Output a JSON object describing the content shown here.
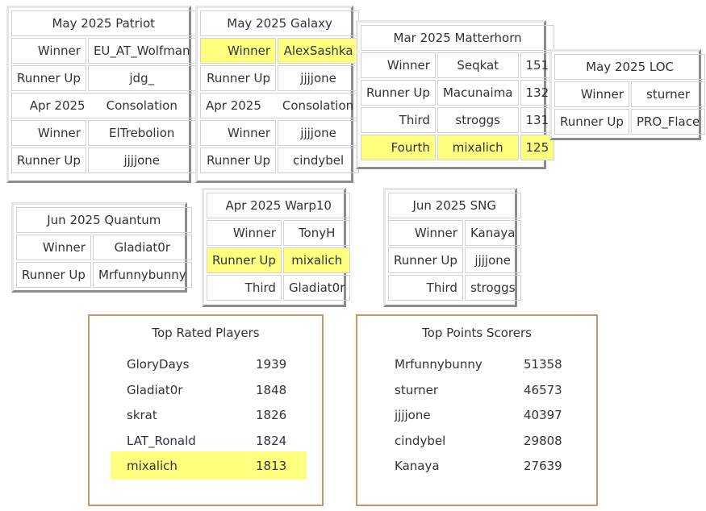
{
  "tournaments": {
    "patriot": {
      "title": "May 2025 Patriot",
      "rows": [
        {
          "label": "Winner",
          "name": "EU_AT_Wolfman"
        },
        {
          "label": "Runner Up",
          "name": "jdg_"
        }
      ],
      "consolation": {
        "month": "Apr 2025",
        "label": "Consolation",
        "rows": [
          {
            "label": "Winner",
            "name": "ElTrebolion"
          },
          {
            "label": "Runner Up",
            "name": "jjjjone"
          }
        ]
      }
    },
    "galaxy": {
      "title": "May 2025 Galaxy",
      "rows": [
        {
          "label": "Winner",
          "name": "AlexSashka"
        },
        {
          "label": "Runner Up",
          "name": "jjjjone"
        }
      ],
      "consolation": {
        "month": "Apr 2025",
        "label": "Consolation",
        "rows": [
          {
            "label": "Winner",
            "name": "jjjjone"
          },
          {
            "label": "Runner Up",
            "name": "cindybel"
          }
        ]
      }
    },
    "matterhorn": {
      "title": "Mar 2025 Matterhorn",
      "rows": [
        {
          "label": "Winner",
          "name": "Seqkat",
          "score": "151"
        },
        {
          "label": "Runner Up",
          "name": "Macunaima",
          "score": "132"
        },
        {
          "label": "Third",
          "name": "stroggs",
          "score": "131"
        },
        {
          "label": "Fourth",
          "name": "mixalich",
          "score": "125"
        }
      ]
    },
    "loc": {
      "title": "May 2025 LOC",
      "rows": [
        {
          "label": "Winner",
          "name": "sturner"
        },
        {
          "label": "Runner Up",
          "name": "PRO_Flace"
        }
      ]
    },
    "quantum": {
      "title": "Jun 2025 Quantum",
      "rows": [
        {
          "label": "Winner",
          "name": "Gladiat0r"
        },
        {
          "label": "Runner Up",
          "name": "Mrfunnybunny"
        }
      ]
    },
    "warp10": {
      "title": "Apr 2025 Warp10",
      "rows": [
        {
          "label": "Winner",
          "name": "TonyH"
        },
        {
          "label": "Runner Up",
          "name": "mixalich"
        },
        {
          "label": "Third",
          "name": "Gladiat0r"
        }
      ]
    },
    "sng": {
      "title": "Jun 2025 SNG",
      "rows": [
        {
          "label": "Winner",
          "name": "Kanaya"
        },
        {
          "label": "Runner Up",
          "name": "jjjjone"
        },
        {
          "label": "Third",
          "name": "stroggs"
        }
      ]
    }
  },
  "top_rated": {
    "title": "Top Rated Players",
    "players": [
      {
        "name": "GloryDays",
        "value": "1939"
      },
      {
        "name": "Gladiat0r",
        "value": "1848"
      },
      {
        "name": "skrat",
        "value": "1826"
      },
      {
        "name": "LAT_Ronald",
        "value": "1824"
      },
      {
        "name": "mixalich",
        "value": "1813"
      }
    ]
  },
  "top_points": {
    "title": "Top Points Scorers",
    "players": [
      {
        "name": "Mrfunnybunny",
        "value": "51358"
      },
      {
        "name": "sturner",
        "value": "46573"
      },
      {
        "name": "jjjjone",
        "value": "40397"
      },
      {
        "name": "cindybel",
        "value": "29808"
      },
      {
        "name": "Kanaya",
        "value": "27639"
      }
    ]
  },
  "colors": {
    "highlight": "#ffff80",
    "panel_border": "#c9956a",
    "cell_border": "#d2d2d2"
  }
}
